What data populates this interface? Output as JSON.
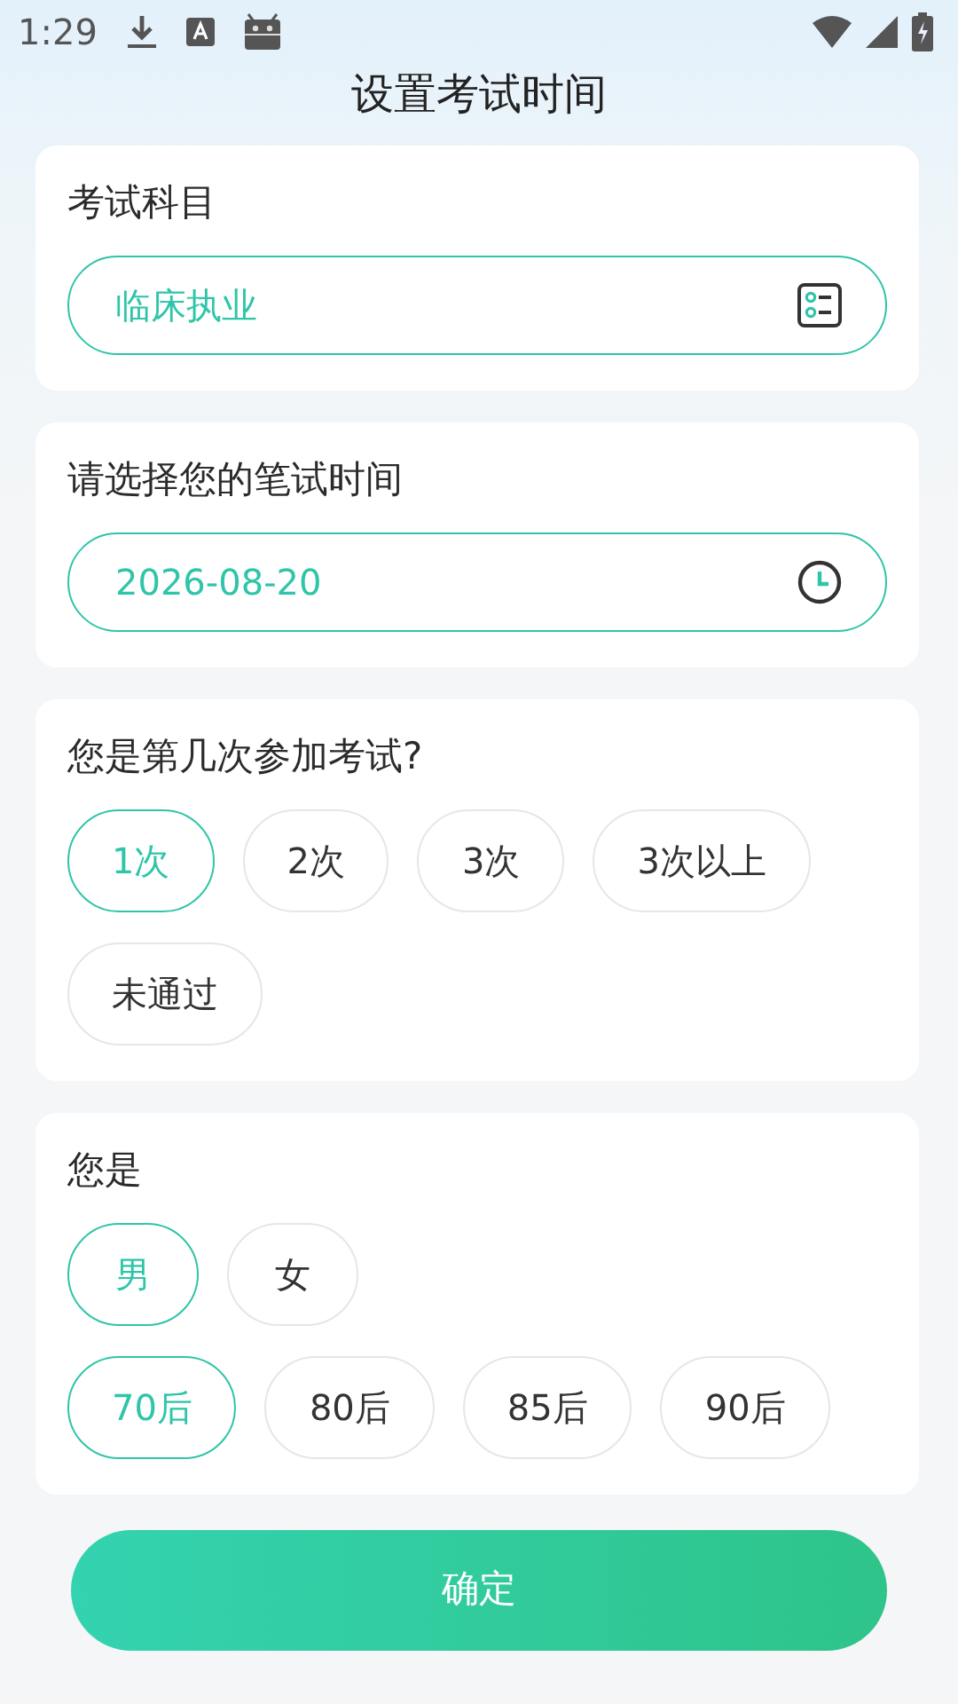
{
  "status_bar": {
    "time": "1:29"
  },
  "title": "设置考试时间",
  "sections": [
    {
      "kind": "select",
      "label": "考试科目",
      "value": "临床执业"
    },
    {
      "kind": "date",
      "label": "请选择您的笔试时间",
      "value": "2026-08-20"
    },
    {
      "kind": "options",
      "label": "您是第几次参加考试?",
      "groups": [
        [
          {
            "label": "1次",
            "selected": true
          },
          {
            "label": "2次",
            "selected": false
          },
          {
            "label": "3次",
            "selected": false
          },
          {
            "label": "3次以上",
            "selected": false
          },
          {
            "label": "未通过",
            "selected": false
          }
        ]
      ]
    },
    {
      "kind": "options",
      "label": "您是",
      "groups": [
        [
          {
            "label": "男",
            "selected": true
          },
          {
            "label": "女",
            "selected": false
          }
        ],
        [
          {
            "label": "70后",
            "selected": true
          },
          {
            "label": "80后",
            "selected": false
          },
          {
            "label": "85后",
            "selected": false
          },
          {
            "label": "90后",
            "selected": false
          }
        ]
      ]
    }
  ],
  "confirm_button": "确定"
}
